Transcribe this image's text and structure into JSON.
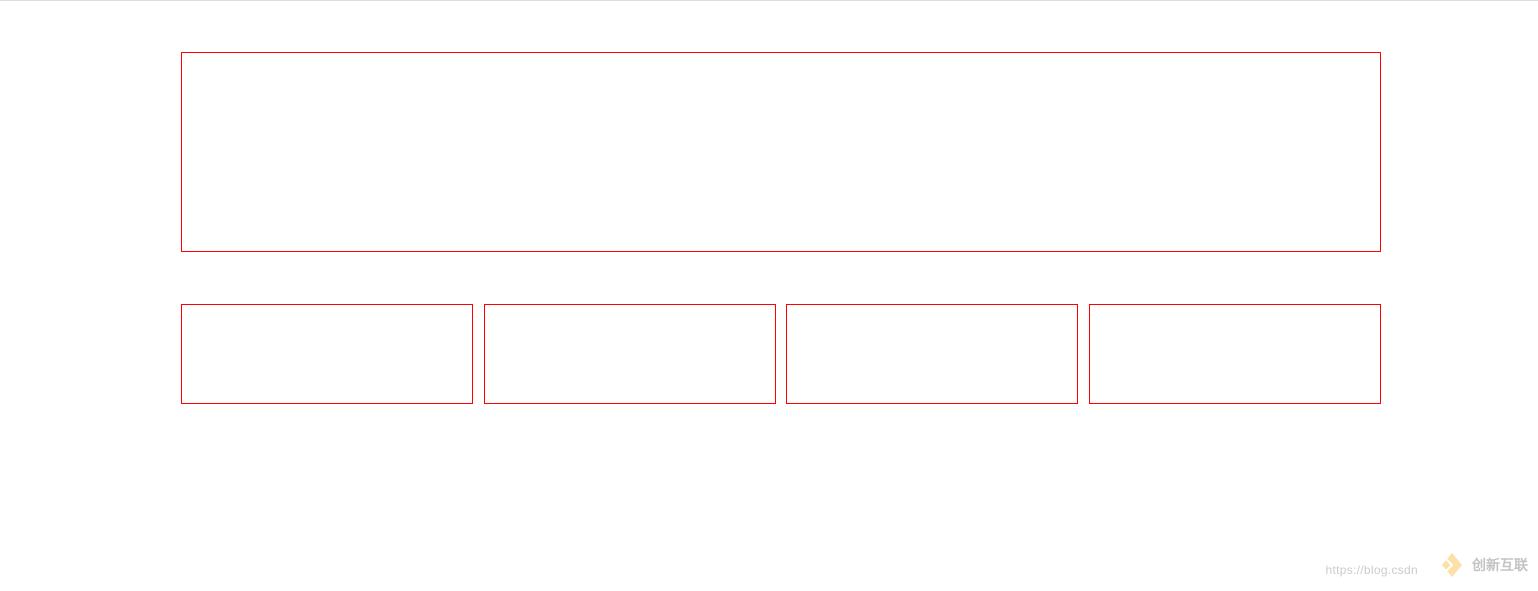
{
  "layout": {
    "header": "",
    "items": [
      "",
      "",
      "",
      ""
    ]
  },
  "watermark": {
    "brand_text": "创新互联",
    "url_text": "https://blog.csdn"
  }
}
